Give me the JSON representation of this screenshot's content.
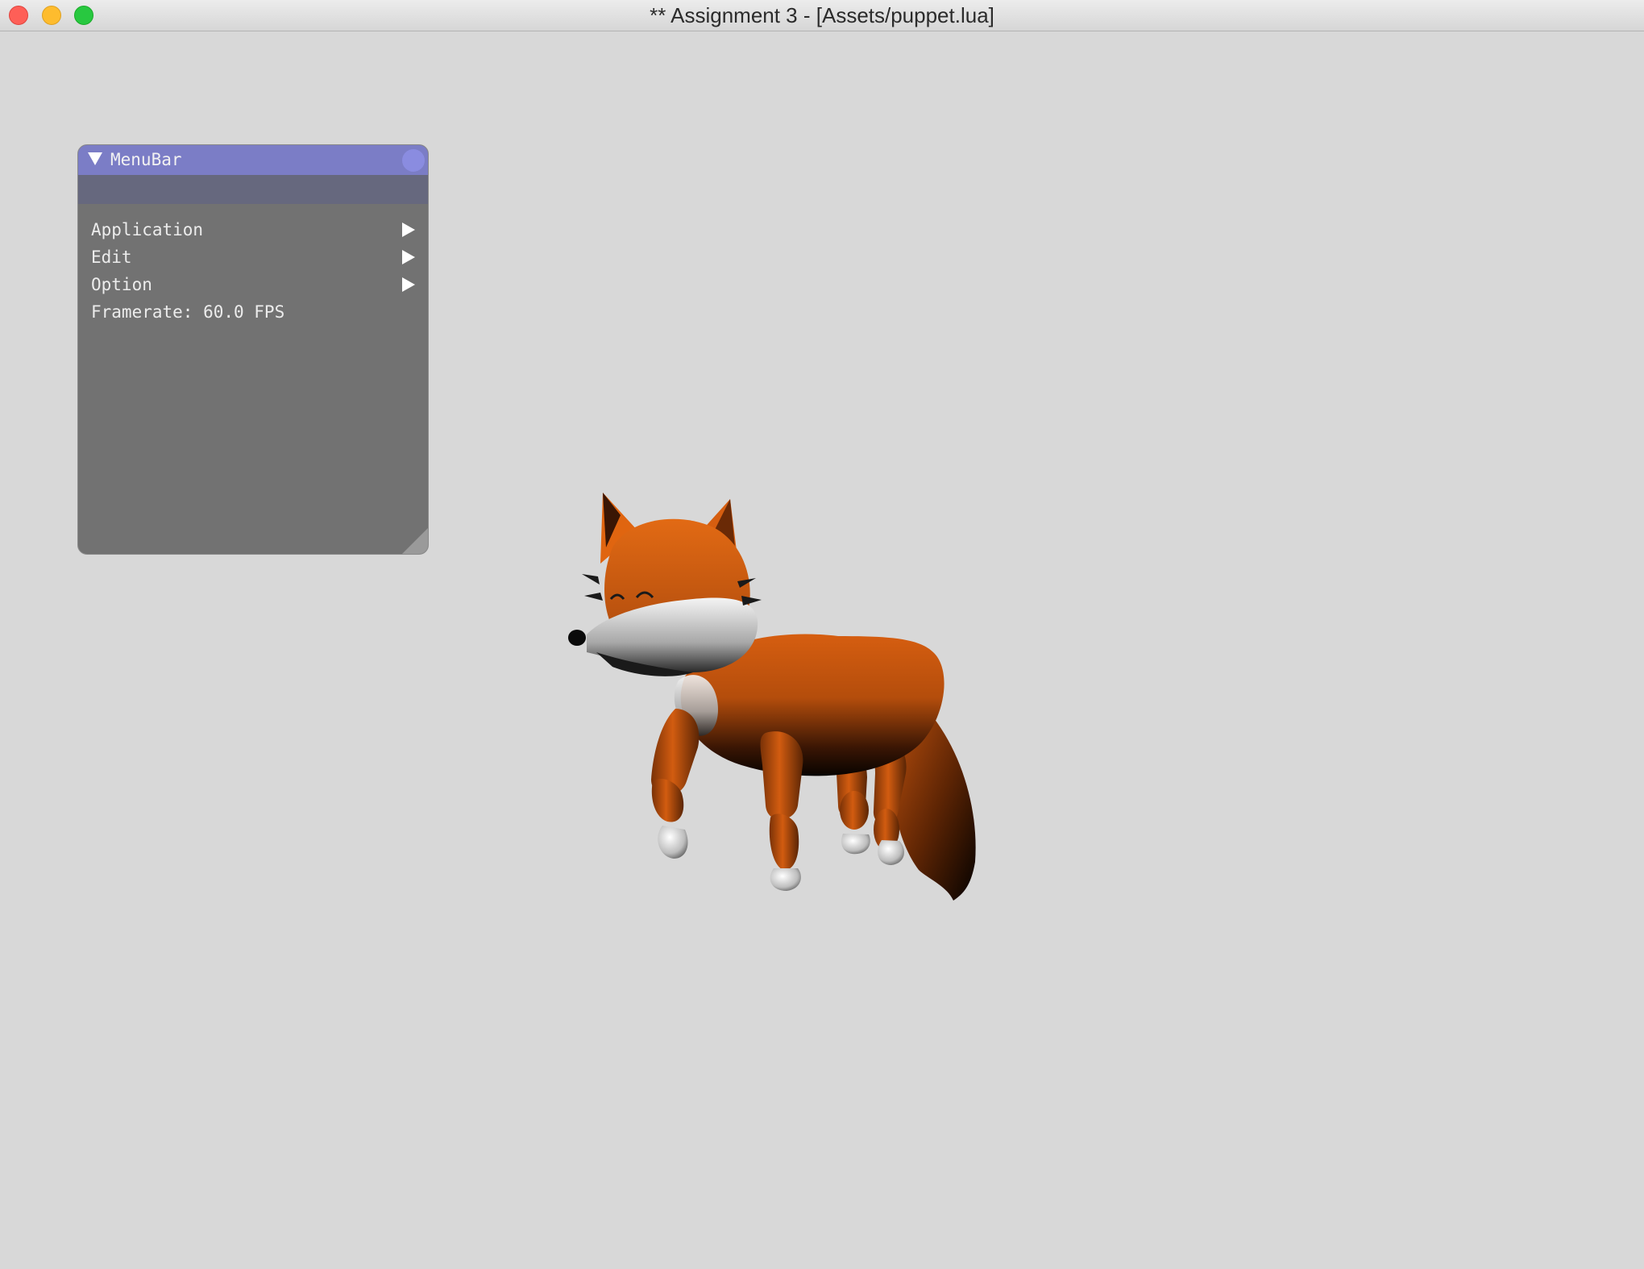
{
  "window": {
    "title": "** Assignment 3 - [Assets/puppet.lua]"
  },
  "imgui": {
    "window_title": "MenuBar",
    "menu_items": [
      {
        "label": "Application",
        "has_submenu": true
      },
      {
        "label": "Edit",
        "has_submenu": true
      },
      {
        "label": "Option",
        "has_submenu": true
      }
    ],
    "framerate_text": "Framerate: 60.0 FPS"
  },
  "scene": {
    "model": "fox-puppet",
    "background_color": "#d8d8d8",
    "body_color": "#c85a12",
    "accent_color": "#e8e8e8"
  }
}
